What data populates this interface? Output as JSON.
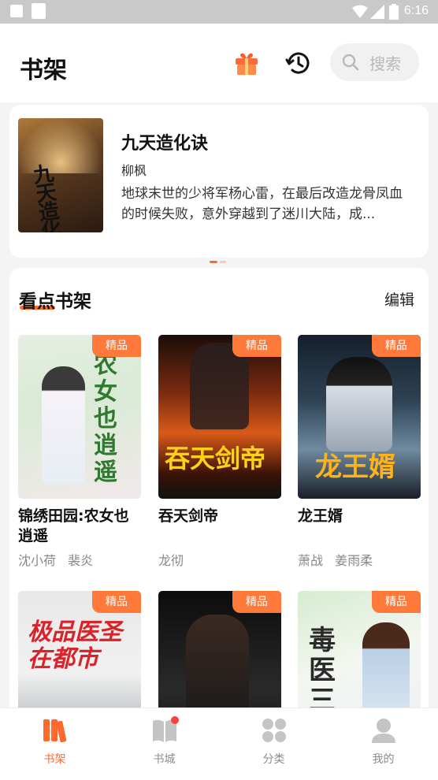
{
  "status_bar": {
    "time": "6:16"
  },
  "header": {
    "title": "书架",
    "search_placeholder": "搜索"
  },
  "banner": {
    "cover_text": "九天造化诀",
    "title": "九天造化诀",
    "author": "柳枫",
    "description": "地球末世的少将军杨心雷，在最后改造龙骨凤血的时候失败，意外穿越到了迷川大陆，成..."
  },
  "shelf": {
    "title": "看点书架",
    "edit_label": "编辑",
    "books": [
      {
        "title": "锦绣田园:农女也逍遥",
        "authors": "沈小荷 裴炎",
        "badge": "精品",
        "cover_text": "农女也逍遥"
      },
      {
        "title": "吞天剑帝",
        "authors": "龙彻",
        "badge": "精品",
        "cover_text": "吞天剑帝"
      },
      {
        "title": "龙王婿",
        "authors": "萧战 姜雨柔",
        "badge": "精品",
        "cover_text": "龙王婿"
      },
      {
        "title": "",
        "authors": "",
        "badge": "精品",
        "cover_text": "极品医圣在都市"
      },
      {
        "title": "",
        "authors": "",
        "badge": "精品",
        "cover_text": ""
      },
      {
        "title": "",
        "authors": "",
        "badge": "精品",
        "cover_text": "毒医三小姐"
      }
    ]
  },
  "bottom_nav": [
    {
      "label": "书架",
      "icon": "bookshelf-icon",
      "active": true
    },
    {
      "label": "书城",
      "icon": "book-store-icon",
      "active": false,
      "has_dot": true
    },
    {
      "label": "分类",
      "icon": "category-icon",
      "active": false
    },
    {
      "label": "我的",
      "icon": "profile-icon",
      "active": false
    }
  ],
  "colors": {
    "accent": "#ff6a2c",
    "badge": "#ff7a3a",
    "nav_inactive": "#c4c4c4",
    "notification_dot": "#ff4040"
  }
}
